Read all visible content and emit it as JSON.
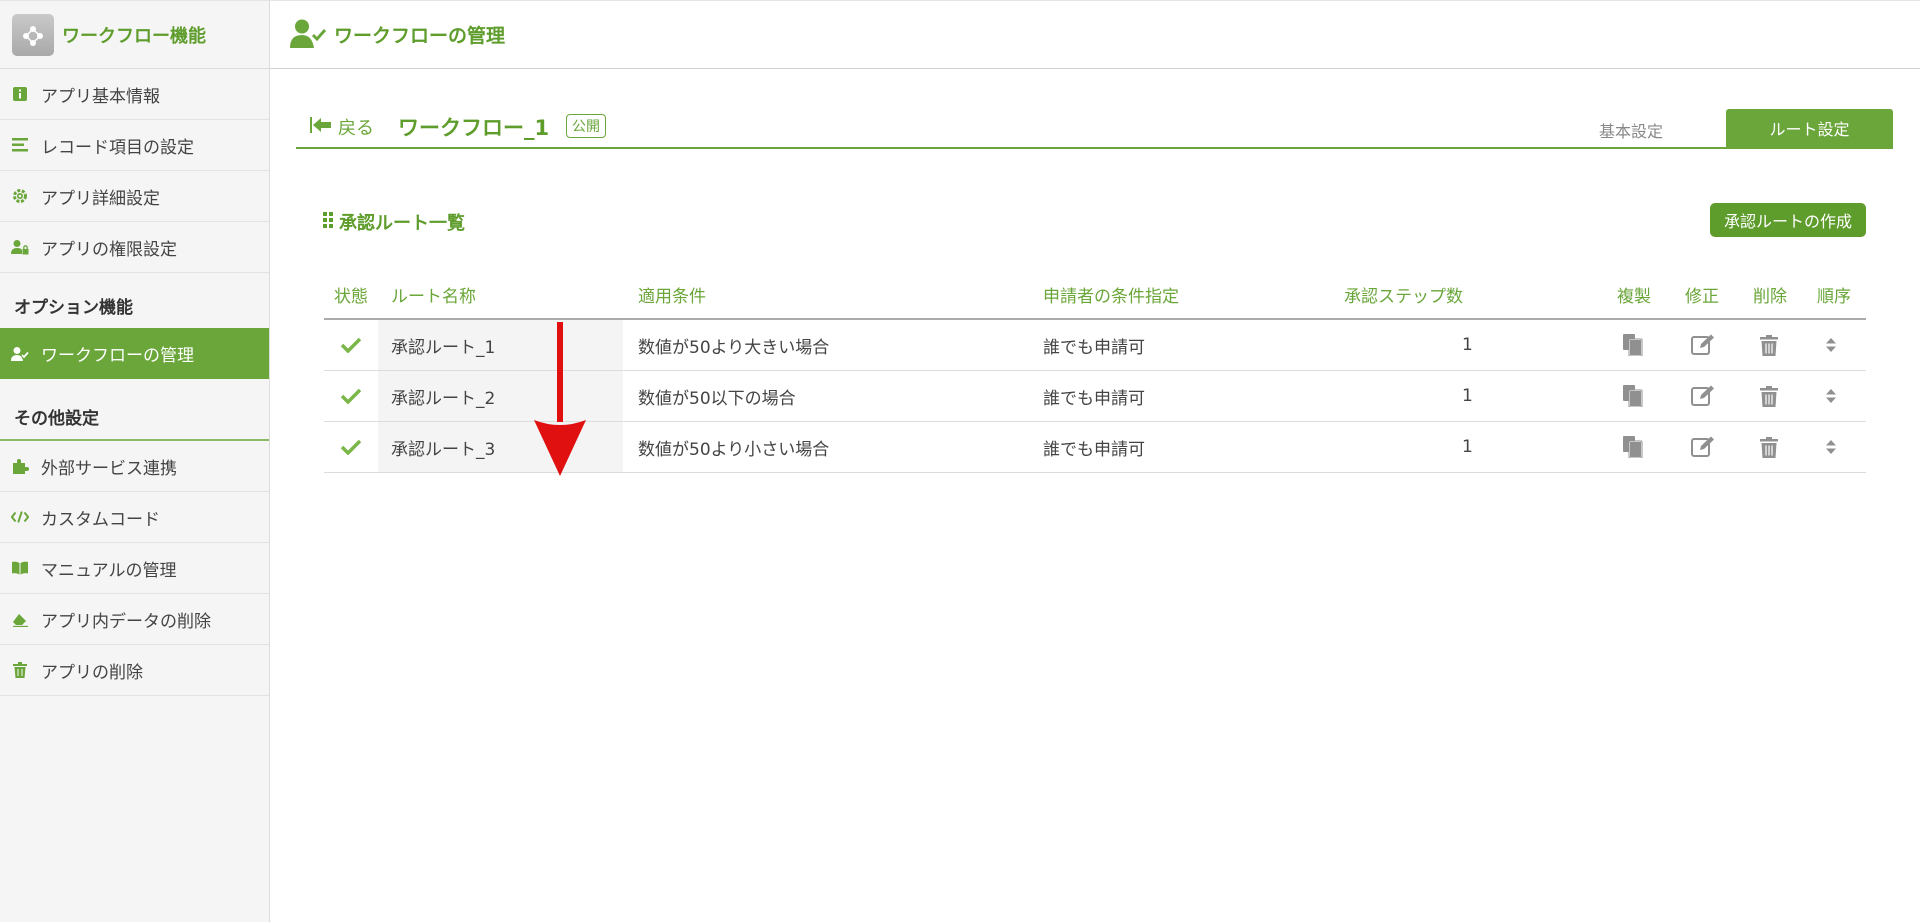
{
  "sidebar": {
    "app_title": "ワークフロー機能",
    "items_top": [
      {
        "label": "アプリ基本情報",
        "icon": "info-icon"
      },
      {
        "label": "レコード項目の設定",
        "icon": "list-icon"
      },
      {
        "label": "アプリ詳細設定",
        "icon": "gear-icon"
      },
      {
        "label": "アプリの権限設定",
        "icon": "user-lock-icon"
      }
    ],
    "section_option": "オプション機能",
    "item_active": {
      "label": "ワークフローの管理",
      "icon": "user-check-icon"
    },
    "section_other": "その他設定",
    "items_other": [
      {
        "label": "外部サービス連携",
        "icon": "puzzle-icon"
      },
      {
        "label": "カスタムコード",
        "icon": "code-icon"
      },
      {
        "label": "マニュアルの管理",
        "icon": "book-icon"
      },
      {
        "label": "アプリ内データの削除",
        "icon": "eraser-icon"
      },
      {
        "label": "アプリの削除",
        "icon": "trash-icon"
      }
    ]
  },
  "header": {
    "title": "ワークフローの管理"
  },
  "page": {
    "back_label": "戻る",
    "workflow_name": "ワークフロー_1",
    "status_badge": "公開",
    "tab_basic": "基本設定",
    "tab_route": "ルート設定"
  },
  "routes": {
    "section_title": "承認ルート一覧",
    "create_button": "承認ルートの作成",
    "columns": {
      "status": "状態",
      "name": "ルート名称",
      "condition": "適用条件",
      "applicant": "申請者の条件指定",
      "steps": "承認ステップ数",
      "copy": "複製",
      "edit": "修正",
      "delete": "削除",
      "order": "順序"
    },
    "rows": [
      {
        "name": "承認ルート_1",
        "condition": "数値が50より大きい場合",
        "applicant": "誰でも申請可",
        "steps": "1"
      },
      {
        "name": "承認ルート_2",
        "condition": "数値が50以下の場合",
        "applicant": "誰でも申請可",
        "steps": "1"
      },
      {
        "name": "承認ルート_3",
        "condition": "数値が50より小さい場合",
        "applicant": "誰でも申請可",
        "steps": "1"
      }
    ]
  },
  "colors": {
    "accent": "#6aa63a",
    "annotation_arrow": "#e01010"
  }
}
